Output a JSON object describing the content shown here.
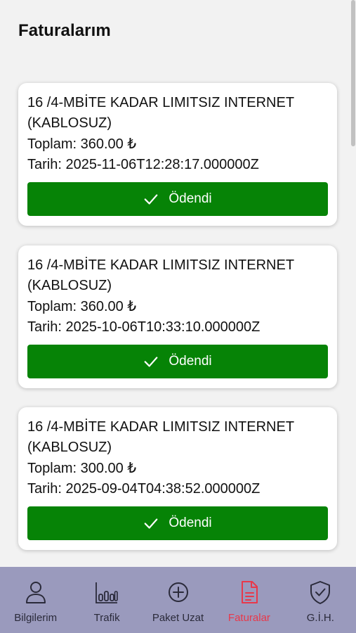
{
  "header": {
    "title": "Faturalarım"
  },
  "invoices": [
    {
      "plan": "16 /4-MBİTE KADAR LIMITSIZ INTERNET (KABLOSUZ)",
      "total": "Toplam: 360.00 ₺",
      "date": "Tarih: 2025-11-06T12:28:17.000000Z",
      "status_label": "Ödendi"
    },
    {
      "plan": "16 /4-MBİTE KADAR LIMITSIZ INTERNET (KABLOSUZ)",
      "total": "Toplam: 360.00 ₺",
      "date": "Tarih: 2025-10-06T10:33:10.000000Z",
      "status_label": "Ödendi"
    },
    {
      "plan": "16 /4-MBİTE KADAR LIMITSIZ INTERNET (KABLOSUZ)",
      "total": "Toplam: 300.00 ₺",
      "date": "Tarih: 2025-09-04T04:38:52.000000Z",
      "status_label": "Ödendi"
    }
  ],
  "bottom_nav": {
    "items": [
      {
        "label": "Bilgilerim",
        "icon": "user-icon"
      },
      {
        "label": "Trafik",
        "icon": "bar-chart-icon"
      },
      {
        "label": "Paket Uzat",
        "icon": "plus-circle-icon"
      },
      {
        "label": "Faturalar",
        "icon": "document-icon"
      },
      {
        "label": "G.İ.H.",
        "icon": "shield-check-icon"
      }
    ],
    "active": "Faturalar"
  },
  "colors": {
    "paid_green": "#068306",
    "nav_background": "#9a9abd",
    "active_nav": "#e8384a",
    "page_background": "#f2f2f2"
  }
}
